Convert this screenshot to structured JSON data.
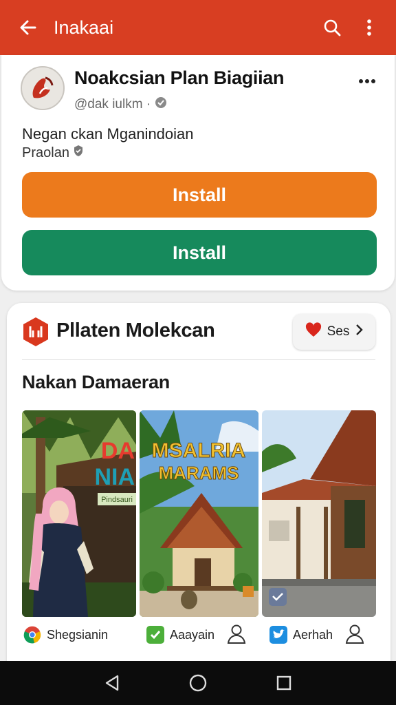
{
  "appbar": {
    "title": "Inakaai",
    "back_icon": "arrow-back-icon",
    "search_icon": "search-icon",
    "more_icon": "more-vert-icon",
    "color": "#d83e22"
  },
  "app": {
    "name": "Noakcsian Plan Biagiian",
    "handle": "@dak iulkm ·",
    "description": "Negan ckan Mganindoian",
    "subtitle": "Praolan",
    "install_primary": "Install",
    "install_secondary": "Install",
    "primary_color": "#ec7a1c",
    "secondary_color": "#168a5c"
  },
  "section": {
    "title": "Pllaten Molekcan",
    "pill_label": "Ses",
    "subheading": "Nakan Damaeran",
    "items": [
      {
        "caption": "DA NIA",
        "sign": "Pindsauri",
        "author": "Shegsianin",
        "badge_icon": "chrome-icon"
      },
      {
        "caption": "MSALRIA MARAMS",
        "author": "Aaayain",
        "badge_icon": "check-icon",
        "badge_color": "#4caf3a"
      },
      {
        "caption": "",
        "author": "Aerhah",
        "badge_icon": "bird-icon",
        "badge_color": "#1d8ee0"
      }
    ]
  },
  "navbar": {
    "back_icon": "nav-back-icon",
    "home_icon": "nav-home-icon",
    "recents_icon": "nav-recents-icon"
  }
}
